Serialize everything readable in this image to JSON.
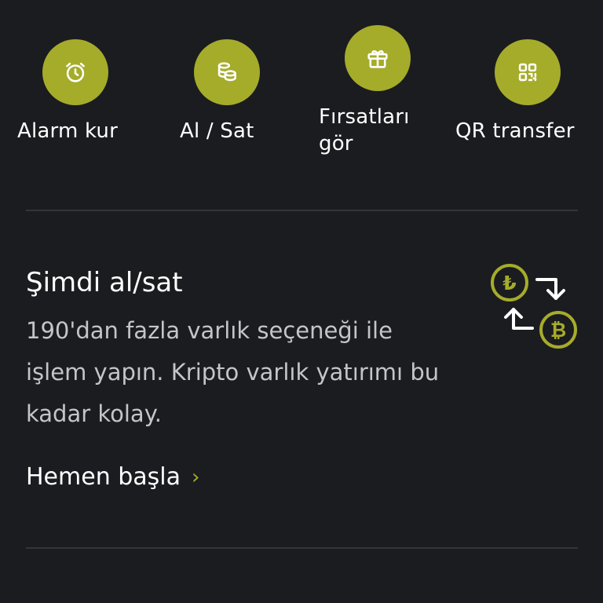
{
  "quick_actions": [
    {
      "label": "Alarm kur",
      "icon": "alarm-clock-icon"
    },
    {
      "label": "Al / Sat",
      "icon": "coins-stack-icon"
    },
    {
      "label": "Fırsatları gör",
      "icon": "gift-icon"
    },
    {
      "label": "QR transfer",
      "icon": "qr-code-icon"
    }
  ],
  "promo": {
    "title": "Şimdi al/sat",
    "description": "190'dan fazla varlık seçeneği ile işlem yapın. Kripto varlık yatırımı bu kadar kolay.",
    "cta_label": "Hemen başla",
    "cta_chevron": "›",
    "lira_symbol": "₺",
    "bitcoin_symbol": "₿"
  },
  "colors": {
    "background": "#1b1c20",
    "accent": "#a5ac2a",
    "text_primary": "#ffffff",
    "text_secondary": "#c4c5c8",
    "divider": "#333539"
  }
}
